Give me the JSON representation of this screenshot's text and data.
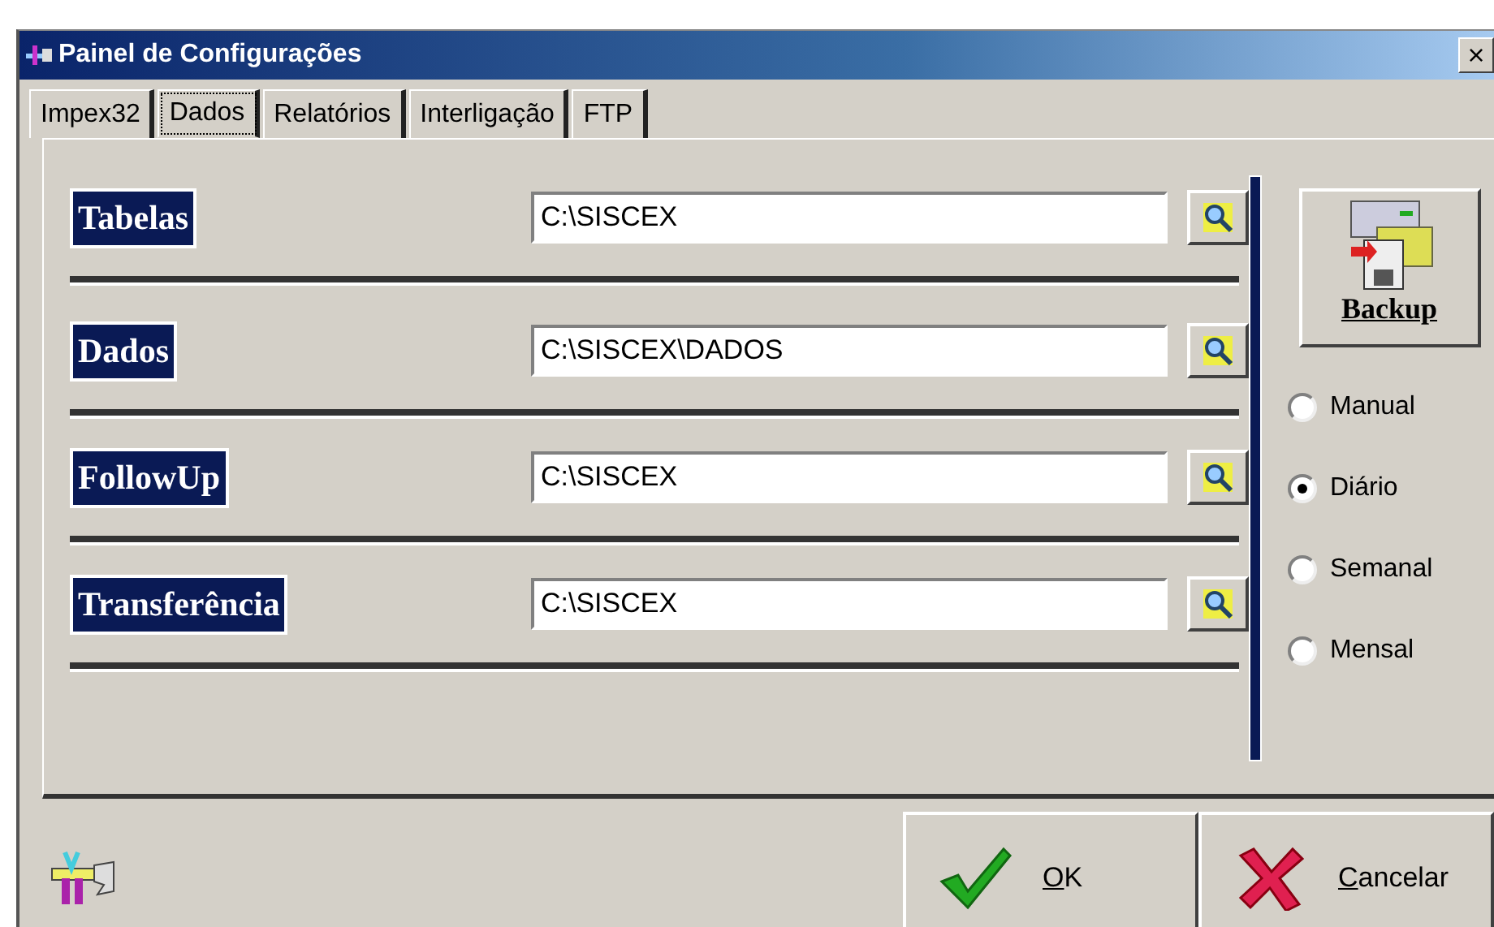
{
  "window": {
    "title": "Painel de Configurações",
    "close": "×"
  },
  "tabs": [
    {
      "label": "Impex32",
      "selected": false
    },
    {
      "label": "Dados",
      "selected": true
    },
    {
      "label": "Relatórios",
      "selected": false
    },
    {
      "label": "Interligação",
      "selected": false
    },
    {
      "label": "FTP",
      "selected": false
    }
  ],
  "paths": [
    {
      "label": "Tabelas",
      "value": "C:\\SISCEX"
    },
    {
      "label": "Dados",
      "value": "C:\\SISCEX\\DADOS"
    },
    {
      "label": "FollowUp",
      "value": "C:\\SISCEX"
    },
    {
      "label": "Transferência",
      "value": "C:\\SISCEX"
    }
  ],
  "backup": {
    "label": "Backup",
    "options": [
      {
        "label": "Manual",
        "selected": false
      },
      {
        "label": "Diário",
        "selected": true
      },
      {
        "label": "Semanal",
        "selected": false
      },
      {
        "label": "Mensal",
        "selected": false
      }
    ]
  },
  "buttons": [
    {
      "kind": "ok",
      "label": "OK"
    },
    {
      "kind": "cancel",
      "label": "Cancelar"
    }
  ]
}
